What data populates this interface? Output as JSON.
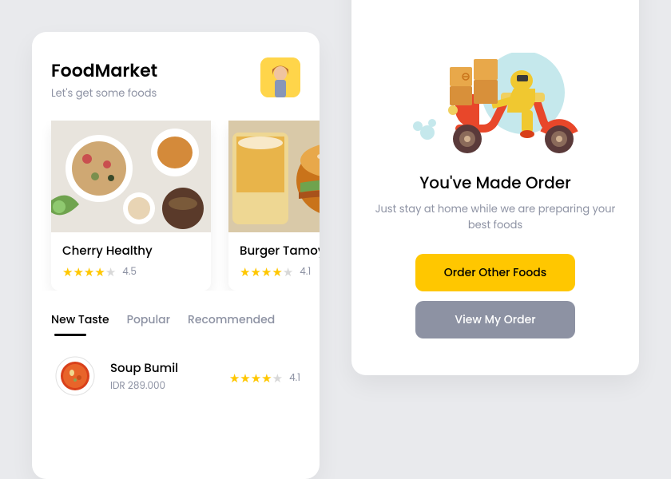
{
  "header": {
    "title": "FoodMarket",
    "subtitle": "Let's get some foods"
  },
  "cards": [
    {
      "title": "Cherry Healthy",
      "rating": 4.5,
      "stars_full": 4,
      "stars_empty": 1
    },
    {
      "title": "Burger Tamoyaki",
      "rating": 4.1,
      "stars_full": 4,
      "stars_empty": 1
    }
  ],
  "tabs": [
    "New Taste",
    "Popular",
    "Recommended"
  ],
  "active_tab": 0,
  "list": [
    {
      "title": "Soup Bumil",
      "price": "IDR 289.000",
      "rating": 4.1,
      "stars_full": 4,
      "stars_empty": 1
    }
  ],
  "order_success": {
    "title": "You've Made Order",
    "subtitle": "Just stay at home while we are preparing your best foods",
    "primary_button": "Order Other Foods",
    "secondary_button": "View My Order"
  }
}
